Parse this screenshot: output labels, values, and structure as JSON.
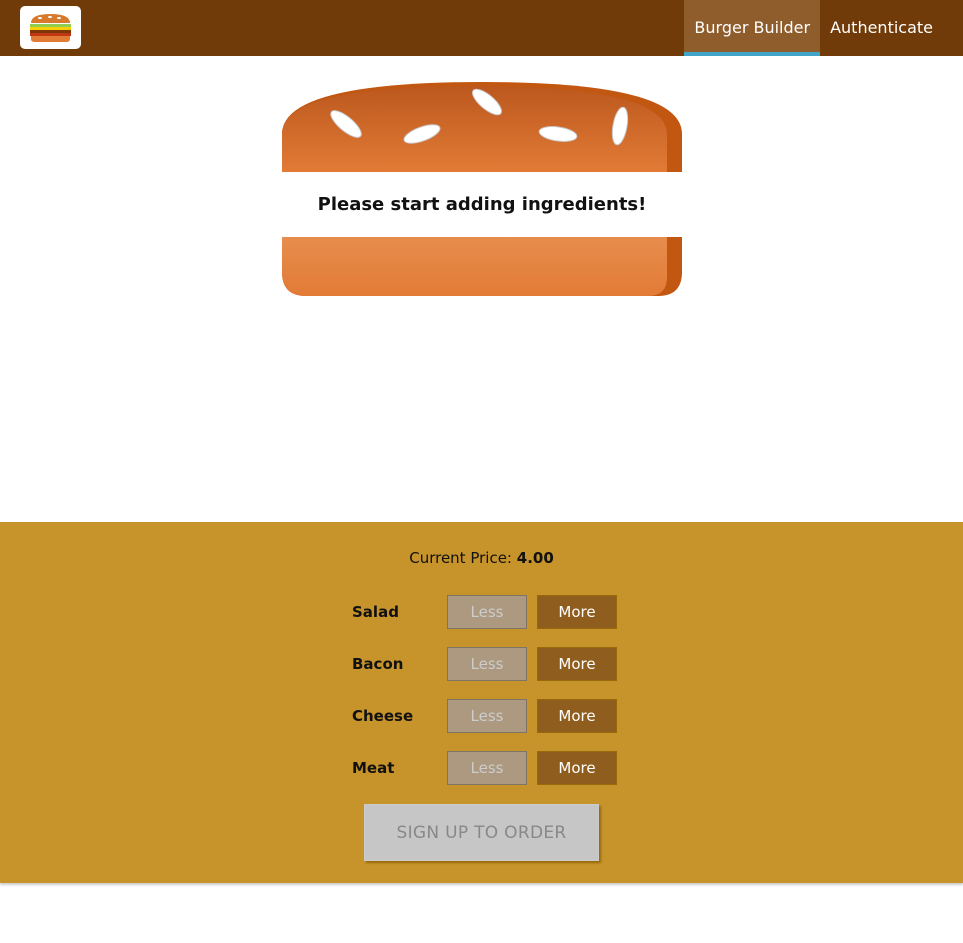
{
  "nav": {
    "logo_alt": "Burger logo",
    "items": [
      {
        "label": "Burger Builder",
        "active": true
      },
      {
        "label": "Authenticate",
        "active": false
      }
    ]
  },
  "burger": {
    "message": "Please start adding ingredients!"
  },
  "build_controls": {
    "price_label": "Current Price:",
    "price_value": "4.00",
    "less_label": "Less",
    "more_label": "More",
    "ingredients": [
      "Salad",
      "Bacon",
      "Cheese",
      "Meat"
    ],
    "order_label": "SIGN UP TO ORDER"
  },
  "colors": {
    "toolbar": "#703b09",
    "active_tab": "#8f5c2c",
    "controls_bg": "#c7932b",
    "bread": "#e27b36",
    "more_button": "#8f5e1e",
    "less_button": "#ac9980",
    "order_disabled": "#c7c6c6"
  }
}
